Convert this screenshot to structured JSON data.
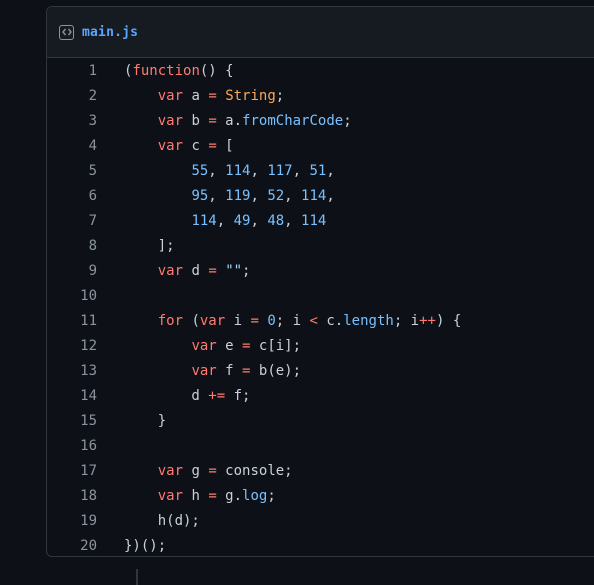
{
  "file": {
    "name": "main.js",
    "icon": "code-file-icon"
  },
  "lines": [
    {
      "n": "1",
      "tokens": [
        {
          "t": "(",
          "c": "plain"
        },
        {
          "t": "function",
          "c": "kw"
        },
        {
          "t": "() {",
          "c": "plain"
        }
      ]
    },
    {
      "n": "2",
      "tokens": [
        {
          "t": "    ",
          "c": "plain"
        },
        {
          "t": "var",
          "c": "kw"
        },
        {
          "t": " a ",
          "c": "plain"
        },
        {
          "t": "=",
          "c": "op"
        },
        {
          "t": " ",
          "c": "plain"
        },
        {
          "t": "String",
          "c": "builtin"
        },
        {
          "t": ";",
          "c": "plain"
        }
      ]
    },
    {
      "n": "3",
      "tokens": [
        {
          "t": "    ",
          "c": "plain"
        },
        {
          "t": "var",
          "c": "kw"
        },
        {
          "t": " b ",
          "c": "plain"
        },
        {
          "t": "=",
          "c": "op"
        },
        {
          "t": " a.",
          "c": "plain"
        },
        {
          "t": "fromCharCode",
          "c": "prop"
        },
        {
          "t": ";",
          "c": "plain"
        }
      ]
    },
    {
      "n": "4",
      "tokens": [
        {
          "t": "    ",
          "c": "plain"
        },
        {
          "t": "var",
          "c": "kw"
        },
        {
          "t": " c ",
          "c": "plain"
        },
        {
          "t": "=",
          "c": "op"
        },
        {
          "t": " [",
          "c": "plain"
        }
      ]
    },
    {
      "n": "5",
      "tokens": [
        {
          "t": "        ",
          "c": "plain"
        },
        {
          "t": "55",
          "c": "num"
        },
        {
          "t": ", ",
          "c": "plain"
        },
        {
          "t": "114",
          "c": "num"
        },
        {
          "t": ", ",
          "c": "plain"
        },
        {
          "t": "117",
          "c": "num"
        },
        {
          "t": ", ",
          "c": "plain"
        },
        {
          "t": "51",
          "c": "num"
        },
        {
          "t": ",",
          "c": "plain"
        }
      ]
    },
    {
      "n": "6",
      "tokens": [
        {
          "t": "        ",
          "c": "plain"
        },
        {
          "t": "95",
          "c": "num"
        },
        {
          "t": ", ",
          "c": "plain"
        },
        {
          "t": "119",
          "c": "num"
        },
        {
          "t": ", ",
          "c": "plain"
        },
        {
          "t": "52",
          "c": "num"
        },
        {
          "t": ", ",
          "c": "plain"
        },
        {
          "t": "114",
          "c": "num"
        },
        {
          "t": ",",
          "c": "plain"
        }
      ]
    },
    {
      "n": "7",
      "tokens": [
        {
          "t": "        ",
          "c": "plain"
        },
        {
          "t": "114",
          "c": "num"
        },
        {
          "t": ", ",
          "c": "plain"
        },
        {
          "t": "49",
          "c": "num"
        },
        {
          "t": ", ",
          "c": "plain"
        },
        {
          "t": "48",
          "c": "num"
        },
        {
          "t": ", ",
          "c": "plain"
        },
        {
          "t": "114",
          "c": "num"
        }
      ]
    },
    {
      "n": "8",
      "tokens": [
        {
          "t": "    ];",
          "c": "plain"
        }
      ]
    },
    {
      "n": "9",
      "tokens": [
        {
          "t": "    ",
          "c": "plain"
        },
        {
          "t": "var",
          "c": "kw"
        },
        {
          "t": " d ",
          "c": "plain"
        },
        {
          "t": "=",
          "c": "op"
        },
        {
          "t": " ",
          "c": "plain"
        },
        {
          "t": "\"\"",
          "c": "str"
        },
        {
          "t": ";",
          "c": "plain"
        }
      ]
    },
    {
      "n": "10",
      "tokens": []
    },
    {
      "n": "11",
      "tokens": [
        {
          "t": "    ",
          "c": "plain"
        },
        {
          "t": "for",
          "c": "kw"
        },
        {
          "t": " (",
          "c": "plain"
        },
        {
          "t": "var",
          "c": "kw"
        },
        {
          "t": " i ",
          "c": "plain"
        },
        {
          "t": "=",
          "c": "op"
        },
        {
          "t": " ",
          "c": "plain"
        },
        {
          "t": "0",
          "c": "num"
        },
        {
          "t": "; i ",
          "c": "plain"
        },
        {
          "t": "<",
          "c": "op"
        },
        {
          "t": " c.",
          "c": "plain"
        },
        {
          "t": "length",
          "c": "prop"
        },
        {
          "t": "; i",
          "c": "plain"
        },
        {
          "t": "++",
          "c": "op"
        },
        {
          "t": ") {",
          "c": "plain"
        }
      ]
    },
    {
      "n": "12",
      "tokens": [
        {
          "t": "        ",
          "c": "plain"
        },
        {
          "t": "var",
          "c": "kw"
        },
        {
          "t": " e ",
          "c": "plain"
        },
        {
          "t": "=",
          "c": "op"
        },
        {
          "t": " c[i];",
          "c": "plain"
        }
      ]
    },
    {
      "n": "13",
      "tokens": [
        {
          "t": "        ",
          "c": "plain"
        },
        {
          "t": "var",
          "c": "kw"
        },
        {
          "t": " f ",
          "c": "plain"
        },
        {
          "t": "=",
          "c": "op"
        },
        {
          "t": " b(e);",
          "c": "plain"
        }
      ]
    },
    {
      "n": "14",
      "tokens": [
        {
          "t": "        d ",
          "c": "plain"
        },
        {
          "t": "+=",
          "c": "op"
        },
        {
          "t": " f;",
          "c": "plain"
        }
      ]
    },
    {
      "n": "15",
      "tokens": [
        {
          "t": "    }",
          "c": "plain"
        }
      ]
    },
    {
      "n": "16",
      "tokens": []
    },
    {
      "n": "17",
      "tokens": [
        {
          "t": "    ",
          "c": "plain"
        },
        {
          "t": "var",
          "c": "kw"
        },
        {
          "t": " g ",
          "c": "plain"
        },
        {
          "t": "=",
          "c": "op"
        },
        {
          "t": " console;",
          "c": "plain"
        }
      ]
    },
    {
      "n": "18",
      "tokens": [
        {
          "t": "    ",
          "c": "plain"
        },
        {
          "t": "var",
          "c": "kw"
        },
        {
          "t": " h ",
          "c": "plain"
        },
        {
          "t": "=",
          "c": "op"
        },
        {
          "t": " g.",
          "c": "plain"
        },
        {
          "t": "log",
          "c": "prop"
        },
        {
          "t": ";",
          "c": "plain"
        }
      ]
    },
    {
      "n": "19",
      "tokens": [
        {
          "t": "    h(d);",
          "c": "plain"
        }
      ]
    },
    {
      "n": "20",
      "tokens": [
        {
          "t": "})();",
          "c": "plain"
        }
      ]
    }
  ],
  "colors": {
    "background": "#0d1117",
    "header_bg": "#161b22",
    "border": "#30363d",
    "filename": "#58a6ff",
    "keyword": "#ff7b72",
    "builtin": "#ffa657",
    "property": "#79c0ff",
    "number": "#79c0ff",
    "string": "#a5d6ff",
    "plain": "#c9d1d9",
    "line_number": "#8b949e"
  }
}
